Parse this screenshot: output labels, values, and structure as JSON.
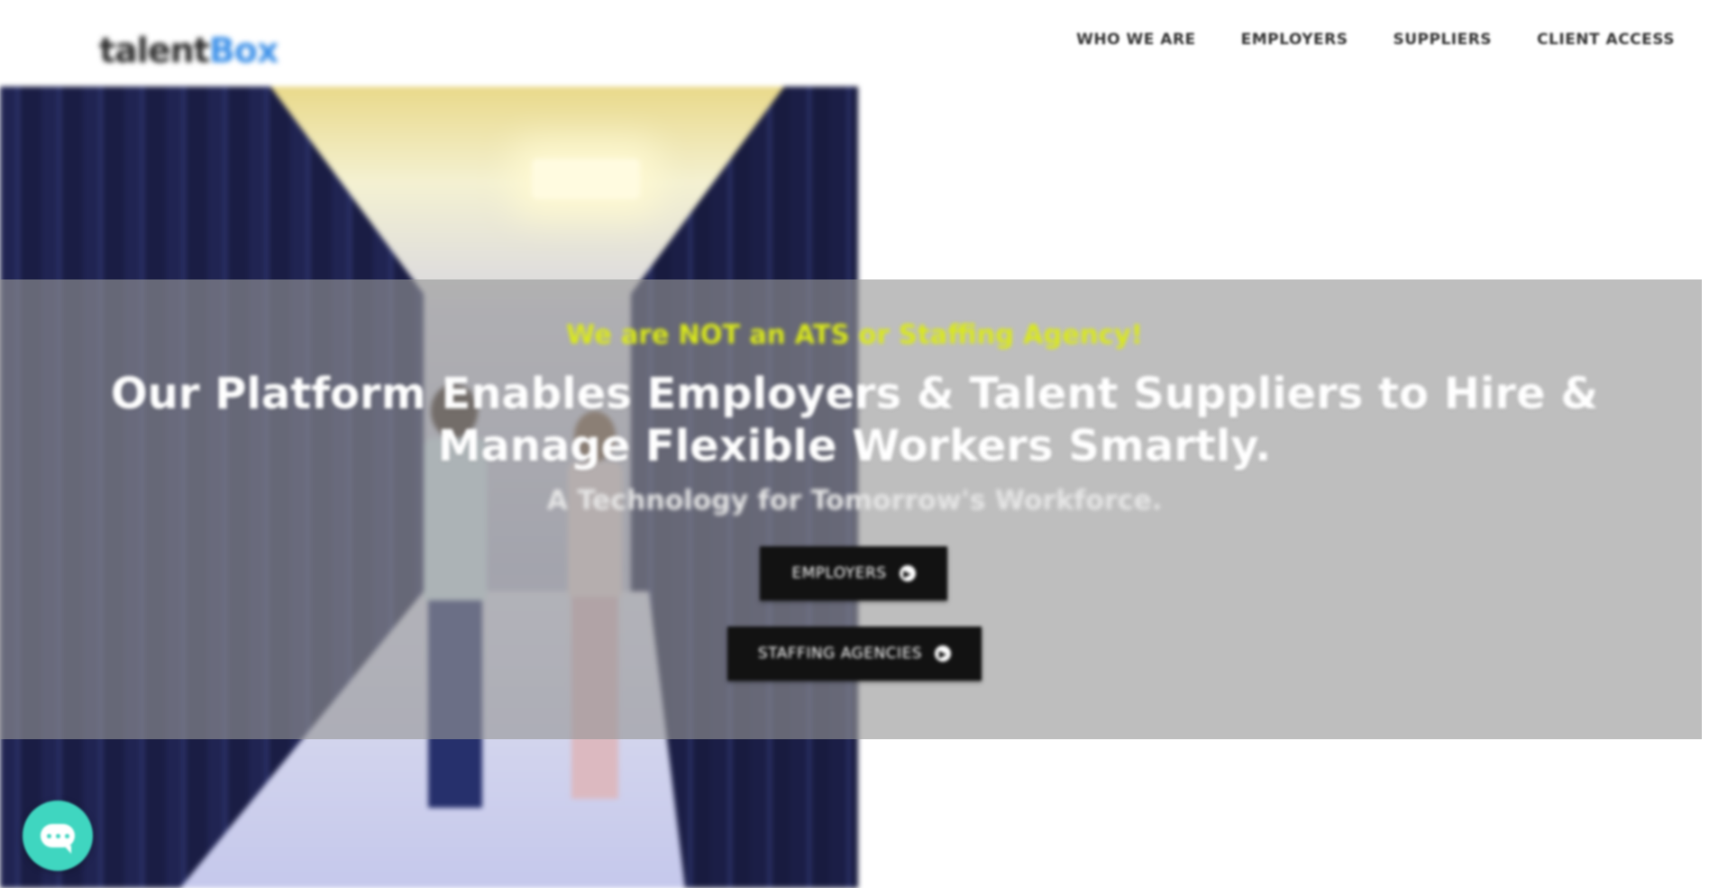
{
  "header": {
    "logo": {
      "part1": "talent",
      "part2": "Box"
    },
    "nav": [
      {
        "label": "WHO WE ARE"
      },
      {
        "label": "EMPLOYERS"
      },
      {
        "label": "SUPPLIERS"
      },
      {
        "label": "CLIENT ACCESS"
      }
    ]
  },
  "hero": {
    "tagline": "We are NOT an ATS or Staffing Agency!",
    "headline": "Our Platform Enables Employers & Talent Suppliers to Hire & Manage Flexible Workers Smartly.",
    "subline": "A Technology for Tomorrow's Workforce.",
    "buttons": [
      {
        "label": "EMPLOYERS"
      },
      {
        "label": "STAFFING AGENCIES"
      }
    ]
  },
  "colors": {
    "tagline": "#d9e81a",
    "overlay": "#969696",
    "button_bg": "#121212",
    "chat": "#3fd6c0"
  },
  "icons": {
    "button_arrow": "arrow-circle-right-icon",
    "chat": "chat-bubble-icon"
  }
}
